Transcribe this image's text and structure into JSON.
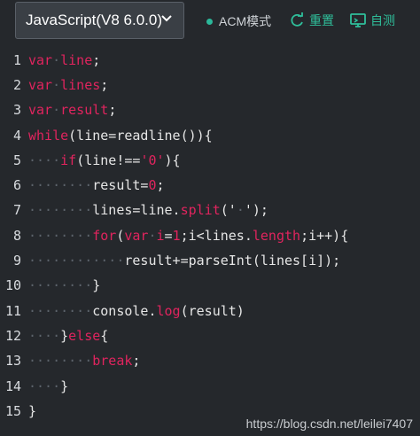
{
  "toolbar": {
    "language_label": "JavaScript(V8 6.0.0)",
    "mode_label": "ACM模式",
    "reset_label": "重置",
    "selftest_label": "自测"
  },
  "colors": {
    "accent": "#2fbf9b",
    "keyword": "#e0245e",
    "background": "#25282c"
  },
  "code": {
    "lines": [
      {
        "n": "1",
        "parts": [
          [
            "kw",
            "var"
          ],
          [
            "ws",
            "·"
          ],
          [
            "kw",
            "line"
          ],
          [
            "txt",
            ";"
          ]
        ]
      },
      {
        "n": "2",
        "parts": [
          [
            "kw",
            "var"
          ],
          [
            "ws",
            "·"
          ],
          [
            "kw",
            "lines"
          ],
          [
            "txt",
            ";"
          ]
        ]
      },
      {
        "n": "3",
        "parts": [
          [
            "kw",
            "var"
          ],
          [
            "ws",
            "·"
          ],
          [
            "kw",
            "result"
          ],
          [
            "txt",
            ";"
          ]
        ]
      },
      {
        "n": "4",
        "parts": [
          [
            "kw",
            "while"
          ],
          [
            "txt",
            "(line=readline()){"
          ]
        ]
      },
      {
        "n": "5",
        "parts": [
          [
            "ws",
            "····"
          ],
          [
            "kw",
            "if"
          ],
          [
            "txt",
            "(line!=="
          ],
          [
            "kw",
            "'0'"
          ],
          [
            "txt",
            "){"
          ]
        ]
      },
      {
        "n": "6",
        "parts": [
          [
            "ws",
            "········"
          ],
          [
            "txt",
            "result="
          ],
          [
            "num",
            "0"
          ],
          [
            "txt",
            ";"
          ]
        ]
      },
      {
        "n": "7",
        "parts": [
          [
            "ws",
            "········"
          ],
          [
            "txt",
            "lines=line."
          ],
          [
            "kw",
            "split"
          ],
          [
            "txt",
            "('"
          ],
          [
            "ws",
            "·"
          ],
          [
            "txt",
            "');"
          ]
        ]
      },
      {
        "n": "8",
        "parts": [
          [
            "ws",
            "········"
          ],
          [
            "kw",
            "for"
          ],
          [
            "txt",
            "("
          ],
          [
            "kw",
            "var"
          ],
          [
            "ws",
            "·"
          ],
          [
            "kw",
            "i"
          ],
          [
            "txt",
            "="
          ],
          [
            "num",
            "1"
          ],
          [
            "txt",
            ";i<lines."
          ],
          [
            "kw",
            "length"
          ],
          [
            "txt",
            ";i++){"
          ]
        ]
      },
      {
        "n": "9",
        "parts": [
          [
            "ws",
            "············"
          ],
          [
            "txt",
            "result+=parseInt(lines[i]);"
          ]
        ]
      },
      {
        "n": "10",
        "parts": [
          [
            "ws",
            "········"
          ],
          [
            "txt",
            "}"
          ]
        ]
      },
      {
        "n": "11",
        "parts": [
          [
            "ws",
            "········"
          ],
          [
            "txt",
            "console."
          ],
          [
            "kw",
            "log"
          ],
          [
            "txt",
            "(result)"
          ]
        ]
      },
      {
        "n": "12",
        "parts": [
          [
            "ws",
            "····"
          ],
          [
            "txt",
            "}"
          ],
          [
            "kw",
            "else"
          ],
          [
            "txt",
            "{"
          ]
        ]
      },
      {
        "n": "13",
        "parts": [
          [
            "ws",
            "········"
          ],
          [
            "kw",
            "break"
          ],
          [
            "txt",
            ";"
          ]
        ]
      },
      {
        "n": "14",
        "parts": [
          [
            "ws",
            "····"
          ],
          [
            "txt",
            "}"
          ]
        ]
      },
      {
        "n": "15",
        "parts": [
          [
            "txt",
            "}"
          ]
        ]
      }
    ]
  },
  "watermark": "https://blog.csdn.net/leilei7407"
}
